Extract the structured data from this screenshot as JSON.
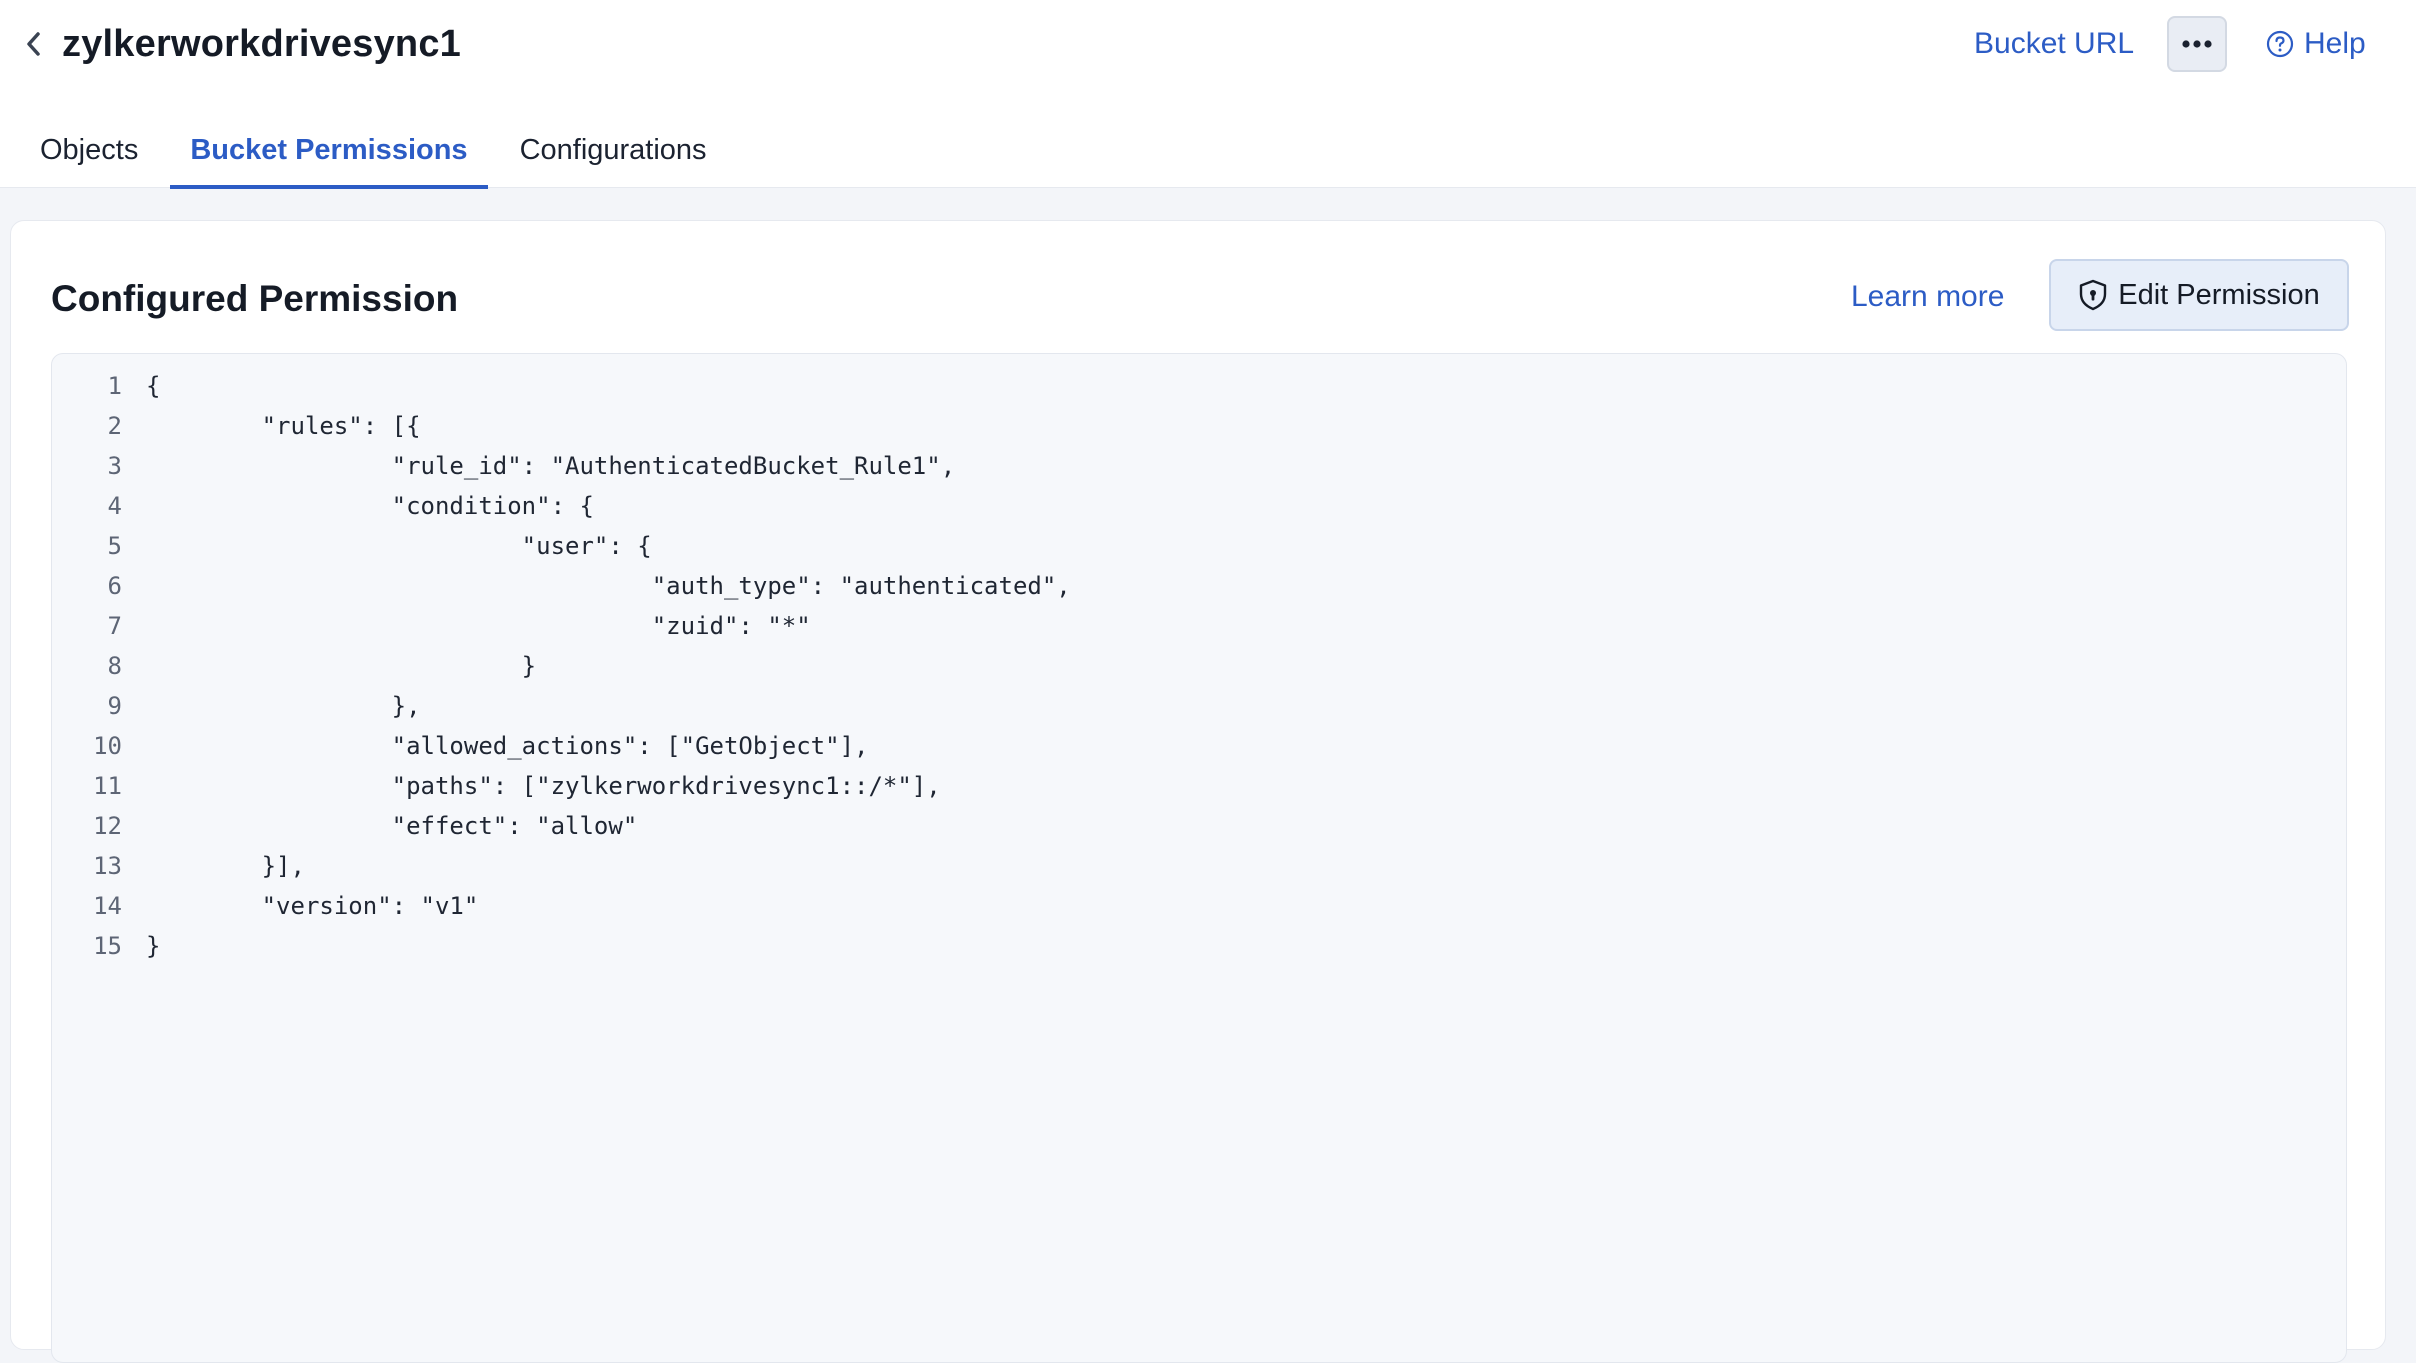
{
  "header": {
    "bucket_name": "zylkerworkdrivesync1",
    "bucket_url_label": "Bucket URL",
    "more_icon": "ellipsis-icon",
    "help_label": "Help"
  },
  "tabs": [
    {
      "label": "Objects",
      "active": false
    },
    {
      "label": "Bucket Permissions",
      "active": true
    },
    {
      "label": "Configurations",
      "active": false
    }
  ],
  "permission": {
    "title": "Configured Permission",
    "learn_more_label": "Learn more",
    "edit_label": "Edit Permission"
  },
  "code": {
    "lines": [
      {
        "n": "1",
        "text": "{"
      },
      {
        "n": "2",
        "text": "        \"rules\": [{"
      },
      {
        "n": "3",
        "text": "                 \"rule_id\": \"AuthenticatedBucket_Rule1\","
      },
      {
        "n": "4",
        "text": "                 \"condition\": {"
      },
      {
        "n": "5",
        "text": "                          \"user\": {"
      },
      {
        "n": "6",
        "text": "                                   \"auth_type\": \"authenticated\","
      },
      {
        "n": "7",
        "text": "                                   \"zuid\": \"*\""
      },
      {
        "n": "8",
        "text": "                          }"
      },
      {
        "n": "9",
        "text": "                 },"
      },
      {
        "n": "10",
        "text": "                 \"allowed_actions\": [\"GetObject\"],"
      },
      {
        "n": "11",
        "text": "                 \"paths\": [\"zylkerworkdrivesync1::/*\"],"
      },
      {
        "n": "12",
        "text": "                 \"effect\": \"allow\""
      },
      {
        "n": "13",
        "text": "        }],"
      },
      {
        "n": "14",
        "text": "        \"version\": \"v1\""
      },
      {
        "n": "15",
        "text": "}"
      }
    ]
  },
  "colors": {
    "accent": "#2c5cc5",
    "page_bg": "#f3f5f9",
    "code_bg": "#f6f8fb"
  }
}
